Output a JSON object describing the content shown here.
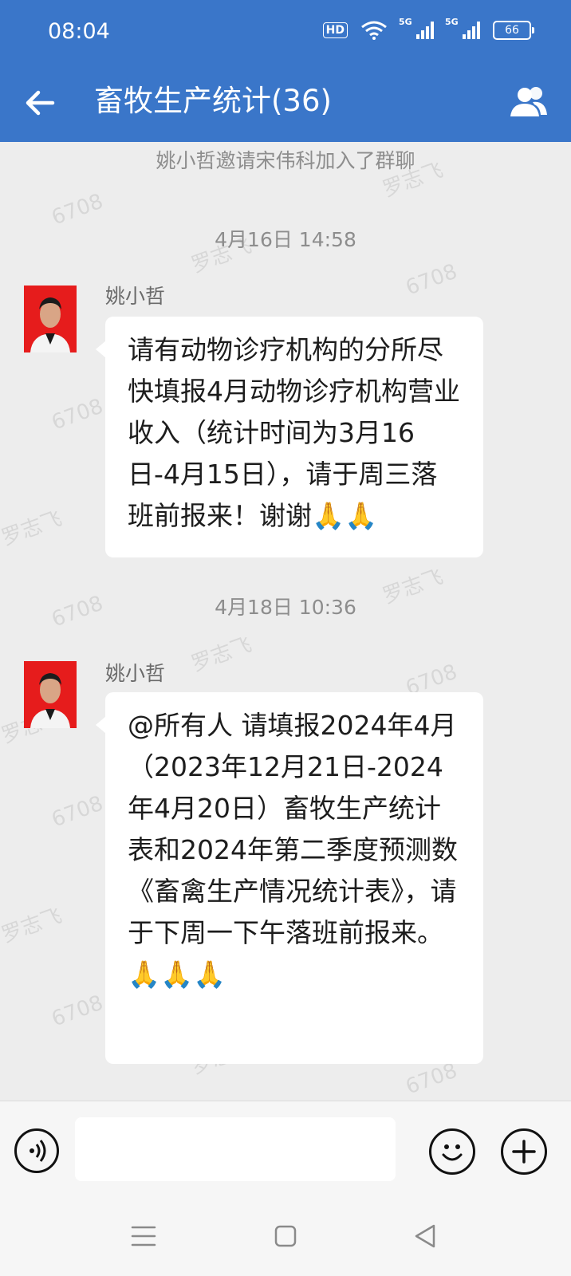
{
  "status": {
    "time": "08:04",
    "hd": "HD",
    "net1": "5G",
    "net2": "5G",
    "battery": "66"
  },
  "header": {
    "title": "畜牧生产统计(36)"
  },
  "watermark": {
    "name": "罗志飞",
    "code": "6708"
  },
  "system_message": "姚小哲邀请宋伟科加入了群聊",
  "messages": [
    {
      "timestamp": "4月16日  14:58",
      "sender": "姚小哲",
      "text": "请有动物诊疗机构的分所尽快填报4月动物诊疗机构营业收入（统计时间为3月16日-4月15日），请于周三落班前报来！谢谢🙏🙏"
    },
    {
      "timestamp": "4月18日  10:36",
      "sender": "姚小哲",
      "text": "@所有人 请填报2024年4月（2023年12月21日-2024年4月20日）畜牧生产统计表和2024年第二季度预测数《畜禽生产情况统计表》，请于下周一下午落班前报来。🙏🙏🙏"
    }
  ],
  "input": {
    "placeholder": ""
  },
  "colors": {
    "accent": "#3a76c9",
    "background": "#ededed",
    "bubble": "#ffffff",
    "avatar_bg": "#e61c1c"
  }
}
